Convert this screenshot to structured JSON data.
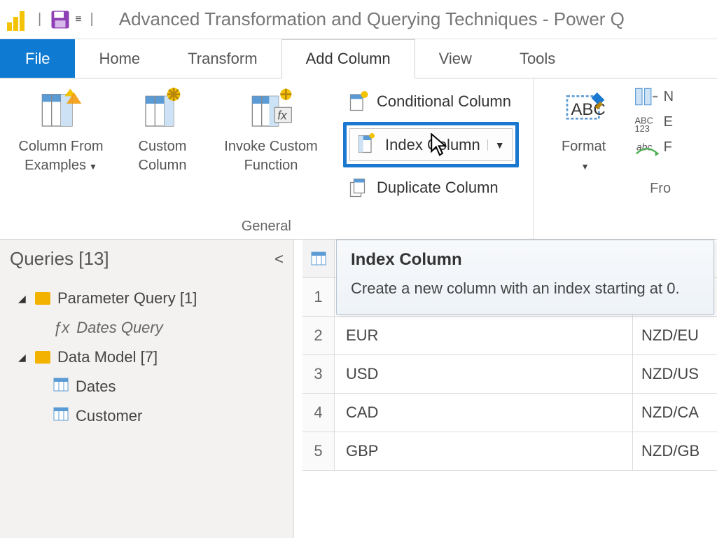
{
  "title": "Advanced Transformation and Querying Techniques - Power Q",
  "tabs": {
    "file": "File",
    "home": "Home",
    "transform": "Transform",
    "add_column": "Add Column",
    "view": "View",
    "tools": "Tools"
  },
  "ribbon": {
    "col_from_examples": "Column From Examples",
    "custom_column": "Custom Column",
    "invoke_custom_fn": "Invoke Custom Function",
    "conditional_column": "Conditional Column",
    "index_column": "Index Column",
    "duplicate_column": "Duplicate Column",
    "general_label": "General",
    "format": "Format",
    "from_label": "Fro"
  },
  "tooltip": {
    "title": "Index Column",
    "body": "Create a new column with an index starting at 0."
  },
  "queries": {
    "header": "Queries [13]",
    "group_param": "Parameter Query [1]",
    "dates_query": "Dates Query",
    "group_model": "Data Model [7]",
    "dates": "Dates",
    "customer": "Customer"
  },
  "table": {
    "rows": [
      {
        "n": "1",
        "c1": "",
        "c2": ""
      },
      {
        "n": "2",
        "c1": "EUR",
        "c2": "NZD/EU"
      },
      {
        "n": "3",
        "c1": "USD",
        "c2": "NZD/US"
      },
      {
        "n": "4",
        "c1": "CAD",
        "c2": "NZD/CA"
      },
      {
        "n": "5",
        "c1": "GBP",
        "c2": "NZD/GB"
      }
    ]
  }
}
